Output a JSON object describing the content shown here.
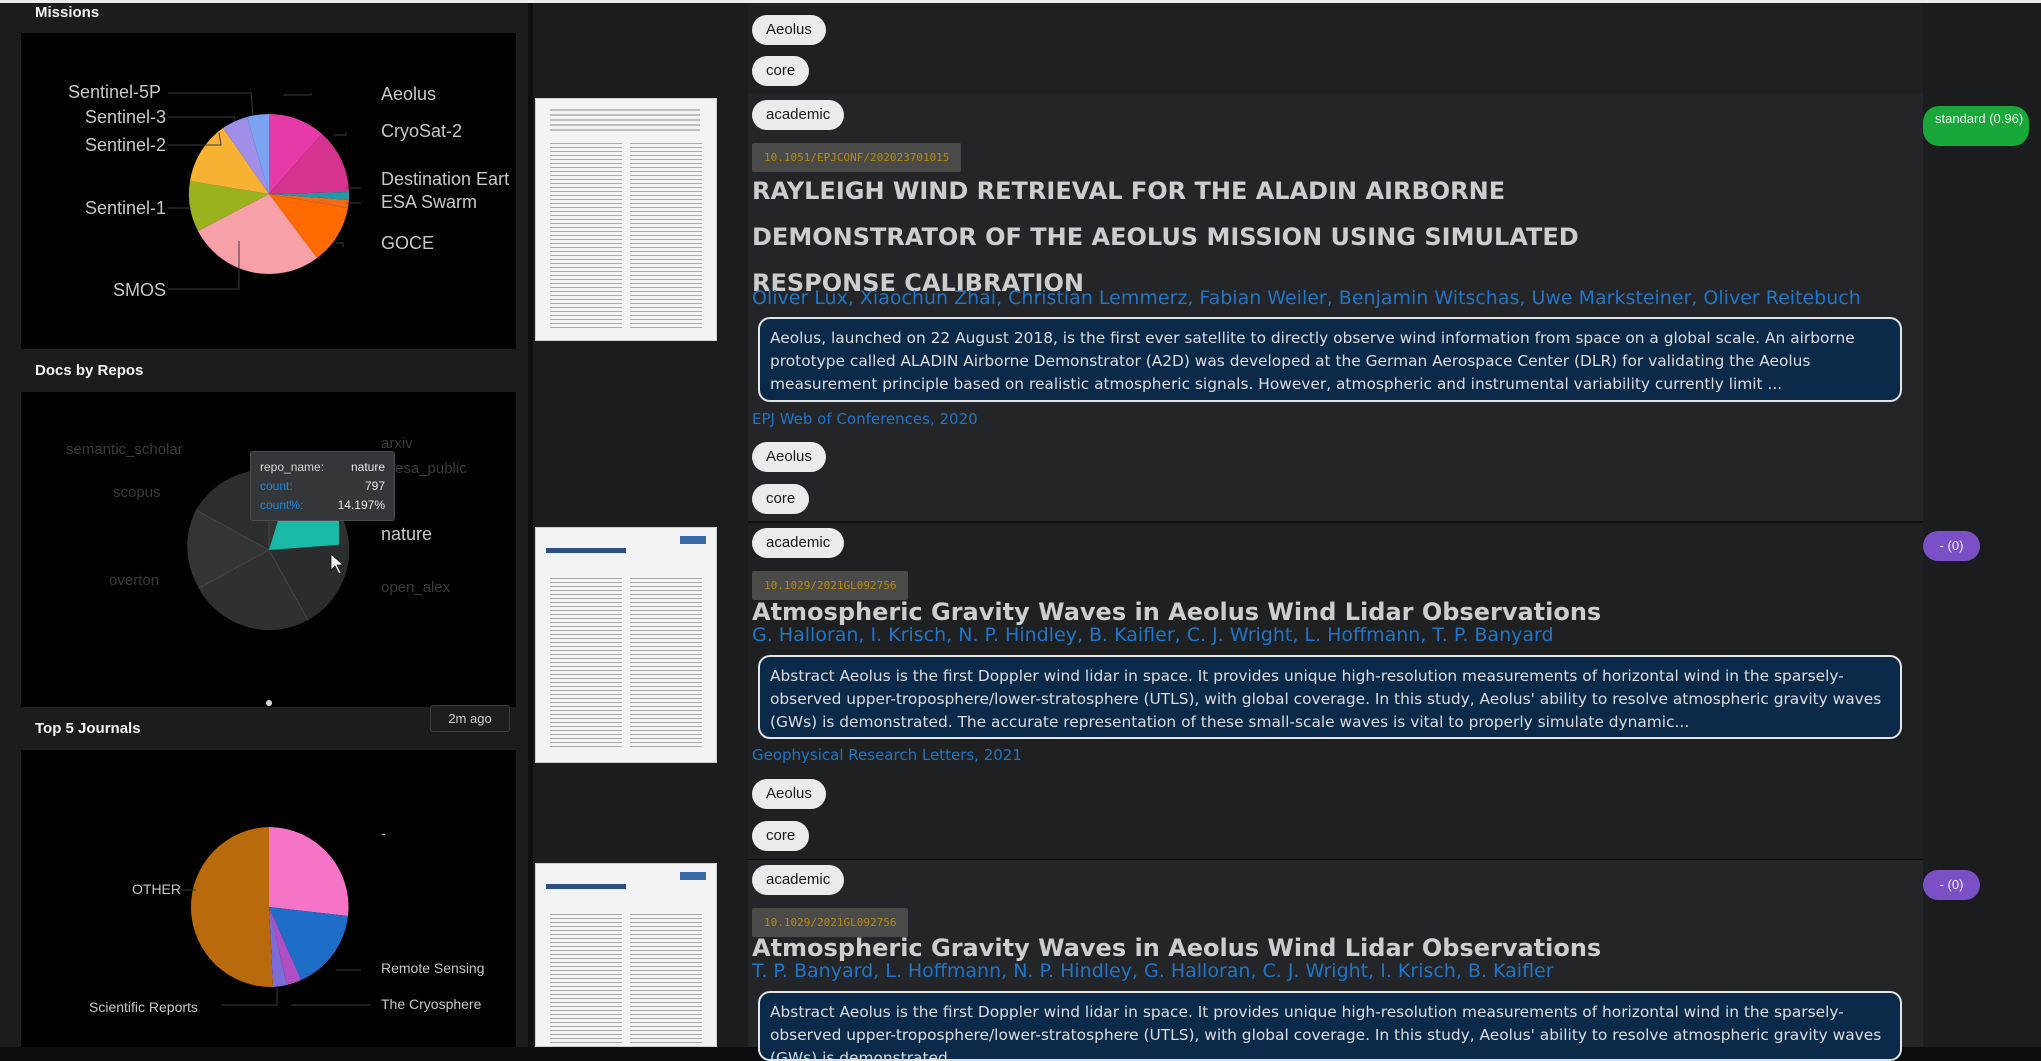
{
  "colors": {
    "link": "#1f76c8",
    "abstract_bg": "#0b2a4a",
    "doi_text": "#b78a14",
    "badge_green": "#18a83a",
    "badge_purple": "#7b4fc6",
    "tooltip_metric": "#1e8ad6"
  },
  "panels": {
    "missions": {
      "title": "Missions",
      "labels": {
        "s5p": "Sentinel-5P",
        "s3": "Sentinel-3",
        "s2": "Sentinel-2",
        "s1": "Sentinel-1",
        "smos": "SMOS",
        "aeolus": "Aeolus",
        "cryosat": "CryoSat-2",
        "dest": "Destination Eart",
        "swarm": "ESA Swarm",
        "goce": "GOCE"
      }
    },
    "repos": {
      "title": "Docs by Repos",
      "labels": {
        "semantic": "semantic_scholar",
        "scopus": "scopus",
        "overton": "overton",
        "nature": "nature",
        "openalex": "open_alex",
        "arxiv": "arxiv",
        "esa": "esa_public"
      },
      "tooltip": {
        "key1": "repo_name:",
        "val1": "nature",
        "key2": "count:",
        "val2": "797",
        "key3": "count%:",
        "val3": "14.197%"
      },
      "age": "2m ago"
    },
    "journals": {
      "title": "Top 5 Journals",
      "labels": {
        "other": "OTHER",
        "dash": "-",
        "remote": "Remote Sensing",
        "scirep": "Scientific Reports",
        "cryo": "The Cryosphere"
      }
    }
  },
  "top_tags": [
    "Aeolus",
    "core"
  ],
  "papers": [
    {
      "type": "academic",
      "doi": "10.1051/EPJCONF/202023701015",
      "title_lines": [
        "RAYLEIGH WIND RETRIEVAL FOR THE ALADIN AIRBORNE",
        "DEMONSTRATOR OF THE AEOLUS MISSION USING SIMULATED",
        "RESPONSE CALIBRATION"
      ],
      "authors": "Oliver Lux, Xiaochun Zhai, Christian Lemmerz, Fabian Weiler, Benjamin Witschas, Uwe Marksteiner, Oliver Reitebuch",
      "abstract": "Aeolus, launched on 22 August 2018, is the first ever satellite to directly observe wind information from space on a global scale. An airborne prototype called ALADIN Airborne Demonstrator (A2D) was developed at the German Aerospace Center (DLR) for validating the Aeolus measurement principle based on realistic atmospheric signals. However, atmospheric and instrumental variability currently limit ...",
      "venue": "EPJ Web of Conferences, 2020",
      "tags": [
        "Aeolus",
        "core"
      ],
      "badge": "standard (0.96)"
    },
    {
      "type": "academic",
      "doi": "10.1029/2021GL092756",
      "title": "Atmospheric Gravity Waves in Aeolus Wind Lidar Observations",
      "authors": "G. Halloran, I. Krisch, N. P. Hindley, B. Kaifler, C. J. Wright, L. Hoffmann, T. P. Banyard",
      "abstract": "Abstract Aeolus is the first Doppler wind lidar in space. It provides unique high-resolution measurements of horizontal wind in the sparsely-observed upper-troposphere/lower-stratosphere (UTLS), with global coverage. In this study, Aeolus' ability to resolve atmospheric gravity waves (GWs) is demonstrated. The accurate representation of these small-scale waves is vital to properly simulate dynamic...",
      "venue": "Geophysical Research Letters, 2021",
      "tags": [
        "Aeolus",
        "core"
      ],
      "badge": "- (0)"
    },
    {
      "type": "academic",
      "doi": "10.1029/2021GL092756",
      "title": "Atmospheric Gravity Waves in Aeolus Wind Lidar Observations",
      "authors": "T. P. Banyard, L. Hoffmann, N. P. Hindley, G. Halloran, C. J. Wright, I. Krisch, B. Kaifler",
      "abstract": "Abstract Aeolus is the first Doppler wind lidar in space. It provides unique high-resolution measurements of horizontal wind in the sparsely-observed upper-troposphere/lower-stratosphere (UTLS), with global coverage. In this study, Aeolus' ability to resolve atmospheric gravity waves (GWs) is demonstrated.",
      "badge": "- (0)"
    }
  ]
}
